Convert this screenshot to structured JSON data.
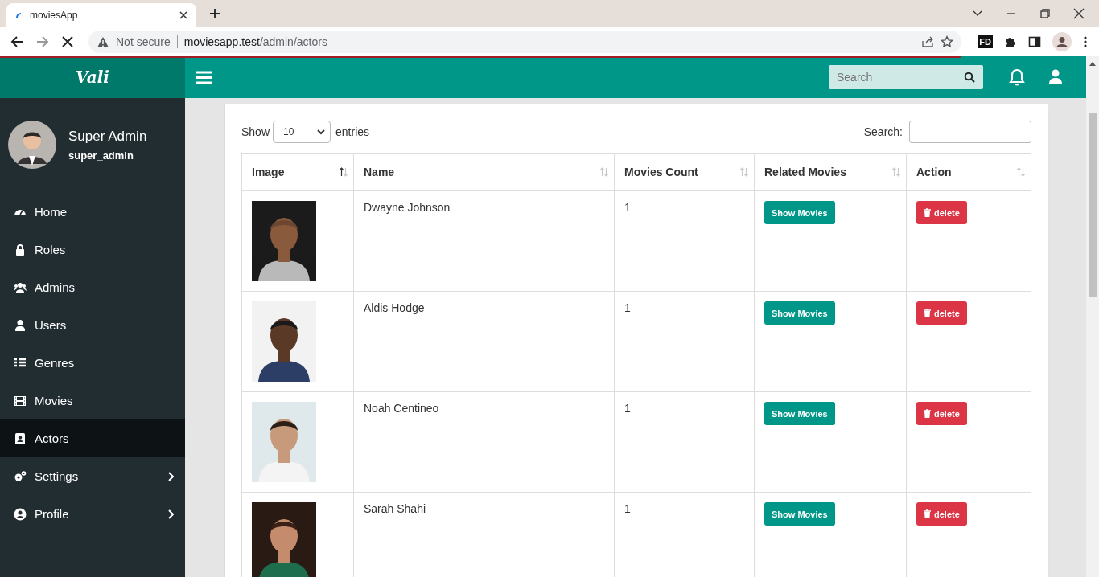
{
  "browser": {
    "tab_title": "moviesApp",
    "security": "Not secure",
    "url_host": "moviesapp.test",
    "url_path": "/admin/actors",
    "loading": true,
    "extension_label": "FD"
  },
  "header": {
    "brand": "Vali",
    "search": {
      "placeholder": "Search"
    }
  },
  "user": {
    "name": "Super Admin",
    "username": "super_admin"
  },
  "nav": [
    {
      "label": "Home",
      "kind": "dashboard",
      "selected": false,
      "submenu": false
    },
    {
      "label": "Roles",
      "kind": "lock",
      "selected": false,
      "submenu": false
    },
    {
      "label": "Admins",
      "kind": "users",
      "selected": false,
      "submenu": false
    },
    {
      "label": "Users",
      "kind": "user",
      "selected": false,
      "submenu": false
    },
    {
      "label": "Genres",
      "kind": "list",
      "selected": false,
      "submenu": false
    },
    {
      "label": "Movies",
      "kind": "film",
      "selected": false,
      "submenu": false
    },
    {
      "label": "Actors",
      "kind": "contact",
      "selected": true,
      "submenu": false
    },
    {
      "label": "Settings",
      "kind": "cogs",
      "selected": false,
      "submenu": true
    },
    {
      "label": "Profile",
      "kind": "profile",
      "selected": false,
      "submenu": true
    }
  ],
  "table": {
    "length": {
      "before": "Show",
      "value": "10",
      "after": "entries"
    },
    "search_label": "Search:",
    "columns": [
      {
        "label": "Image",
        "sorted": true
      },
      {
        "label": "Name",
        "sorted": false
      },
      {
        "label": "Movies Count",
        "sorted": false
      },
      {
        "label": "Related Movies",
        "sorted": false
      },
      {
        "label": "Action",
        "sorted": false
      }
    ],
    "rows": [
      {
        "name": "Dwayne Johnson",
        "movies_count": "1",
        "show_button": "Show Movies",
        "delete_button": "delete"
      },
      {
        "name": "Aldis Hodge",
        "movies_count": "1",
        "show_button": "Show Movies",
        "delete_button": "delete"
      },
      {
        "name": "Noah Centineo",
        "movies_count": "1",
        "show_button": "Show Movies",
        "delete_button": "delete"
      },
      {
        "name": "Sarah Shahi",
        "movies_count": "1",
        "show_button": "Show Movies",
        "delete_button": "delete"
      }
    ]
  }
}
